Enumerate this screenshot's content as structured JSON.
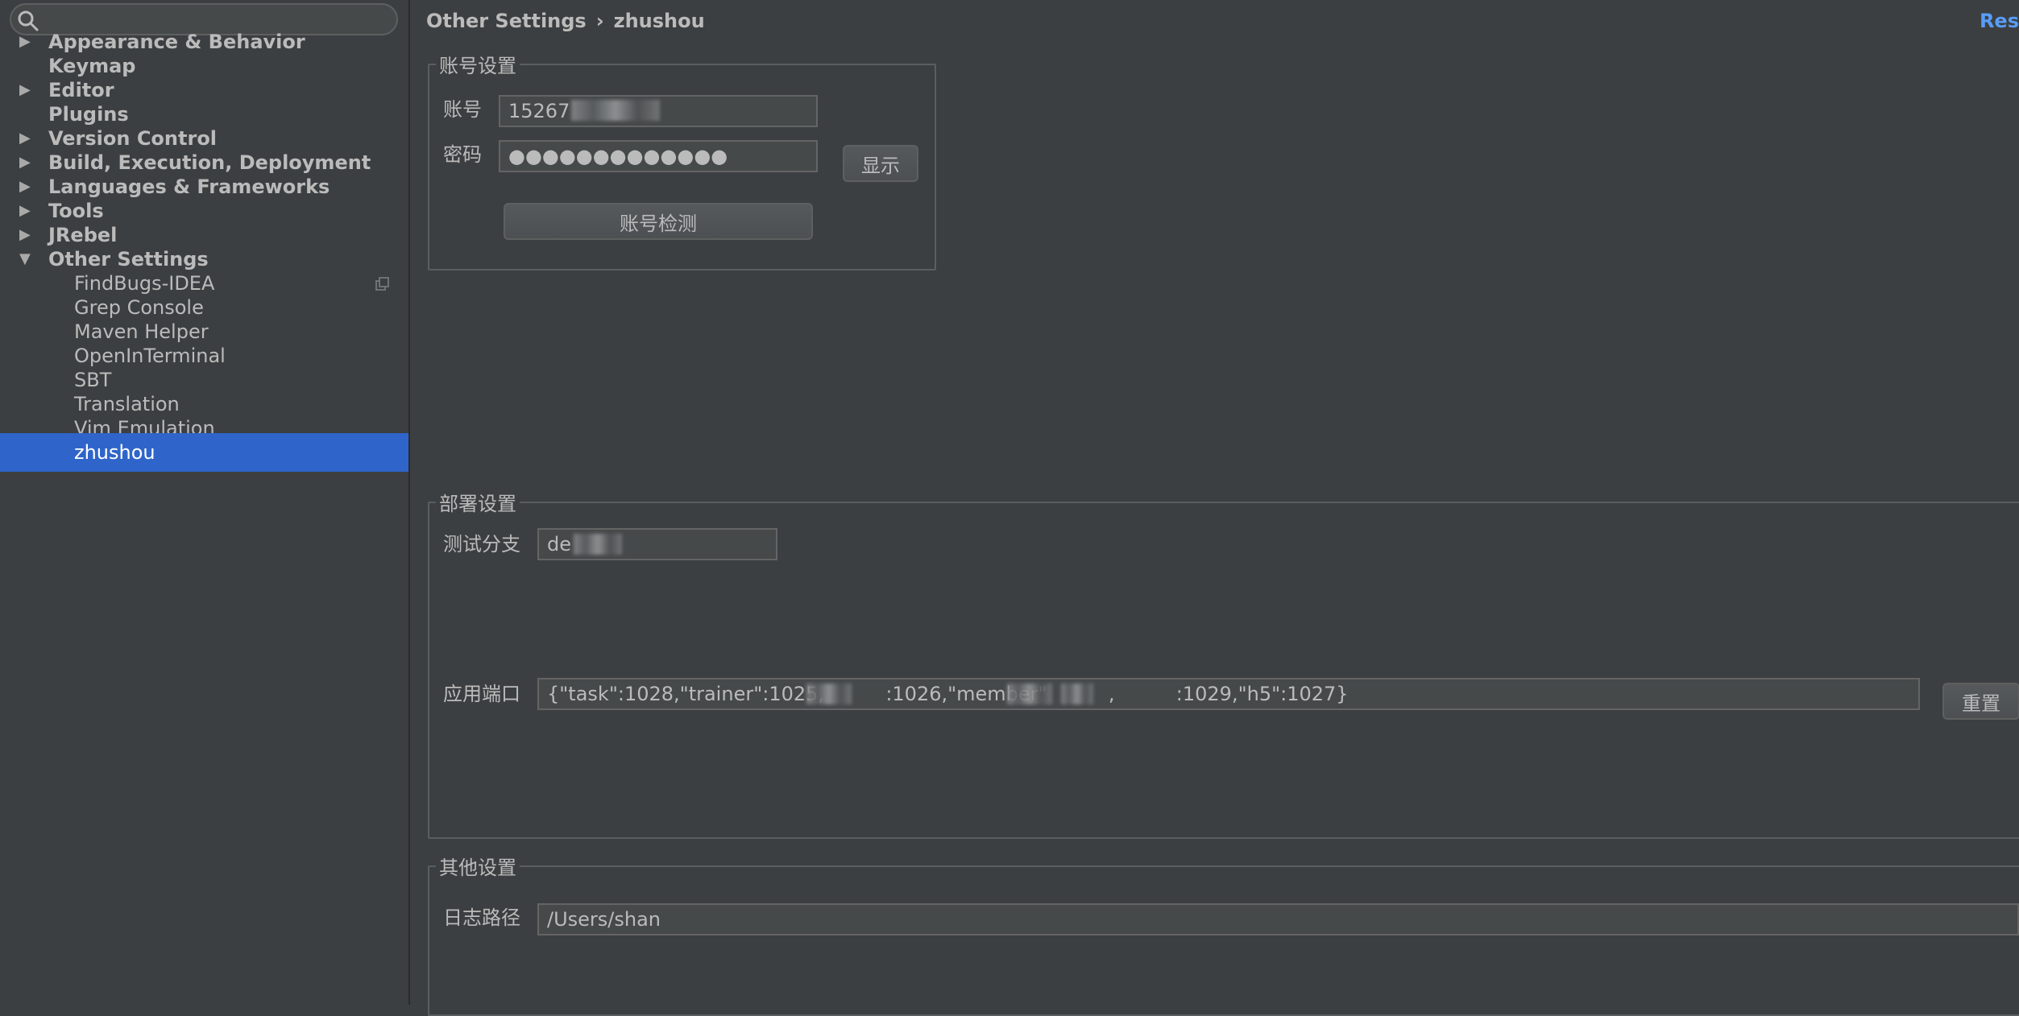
{
  "search": {
    "placeholder": "",
    "value": ""
  },
  "sidebar": {
    "items": [
      {
        "label": "Appearance & Behavior",
        "arrow": "▶"
      },
      {
        "label": "Keymap",
        "arrow": ""
      },
      {
        "label": "Editor",
        "arrow": "▶"
      },
      {
        "label": "Plugins",
        "arrow": ""
      },
      {
        "label": "Version Control",
        "arrow": "▶"
      },
      {
        "label": "Build, Execution, Deployment",
        "arrow": "▶"
      },
      {
        "label": "Languages & Frameworks",
        "arrow": "▶"
      },
      {
        "label": "Tools",
        "arrow": "▶"
      },
      {
        "label": "JRebel",
        "arrow": "▶"
      },
      {
        "label": "Other Settings",
        "arrow": "▼"
      }
    ],
    "sub_items": [
      {
        "label": "FindBugs-IDEA"
      },
      {
        "label": "Grep Console"
      },
      {
        "label": "Maven Helper"
      },
      {
        "label": "OpenInTerminal"
      },
      {
        "label": "SBT"
      },
      {
        "label": "Translation"
      },
      {
        "label": "Vim Emulation"
      },
      {
        "label": "zhushou",
        "selected": true
      }
    ]
  },
  "header": {
    "breadcrumb_parent": "Other Settings",
    "breadcrumb_sep": "›",
    "breadcrumb_current": "zhushou",
    "reset_label": "Res"
  },
  "account": {
    "title": "账号设置",
    "account_label": "账号",
    "account_value": "15267",
    "password_label": "密码",
    "password_value": "●●●●●●●●●●●●●",
    "show_button": "显示",
    "check_button": "账号检测"
  },
  "deploy": {
    "title": "部署设置",
    "branch_label": "测试分支",
    "branch_value": "de",
    "ports_label": "应用端口",
    "ports_value": "{\"task\":1028,\"trainer\":1025,          :1026,\"member\"          ,          :1029,\"h5\":1027}",
    "reset_button": "重置"
  },
  "other": {
    "title": "其他设置",
    "log_label": "日志路径",
    "log_value": "/Users/shan"
  },
  "colors": {
    "background": "#3c3f41",
    "selection": "#2f65ca",
    "link": "#589df6",
    "text": "#bbbbbb"
  }
}
